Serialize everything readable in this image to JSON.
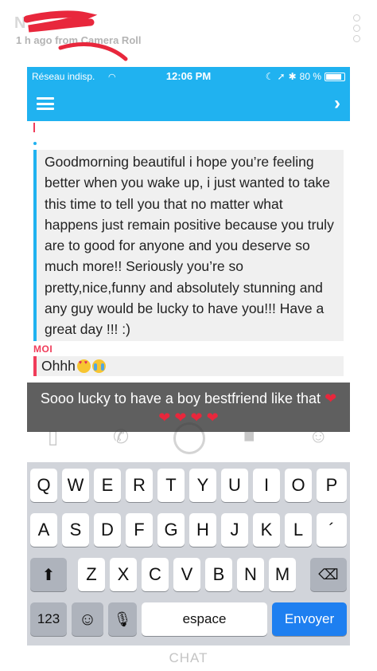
{
  "story": {
    "sender": "N",
    "time": "1 h ago from Camera Roll"
  },
  "status_bar": {
    "carrier": "Réseau indisp.",
    "time": "12:06 PM",
    "battery": "80 %"
  },
  "chat": {
    "friend_message": "Goodmorning beautiful i hope you’re feeling better when you wake up, i just wanted to take this time to tell you that no matter what happens just remain positive because you truly are to good for anyone and you deserve so much more!! Seriously you’re so pretty,nice,funny and absolutely stunning and any guy would be lucky to have you!!! Have a great day !!! :)",
    "me_label": "MOI",
    "me_message": "Ohhh"
  },
  "caption": {
    "text": "Sooo lucky to have a boy bestfriend like that"
  },
  "keyboard": {
    "row1": [
      "Q",
      "W",
      "E",
      "R",
      "T",
      "Y",
      "U",
      "I",
      "O",
      "P"
    ],
    "row2": [
      "A",
      "S",
      "D",
      "F",
      "G",
      "H",
      "J",
      "K",
      "L",
      "´"
    ],
    "row3": [
      "Z",
      "X",
      "C",
      "V",
      "B",
      "N",
      "M"
    ],
    "numbers_key": "123",
    "space_key": "espace",
    "send_key": "Envoyer"
  },
  "footer": {
    "label": "CHAT"
  },
  "colors": {
    "accent_blue": "#20b2f0",
    "me_red": "#f03c5a",
    "send_blue": "#1e7ff0",
    "heart_red": "#e8273c"
  }
}
